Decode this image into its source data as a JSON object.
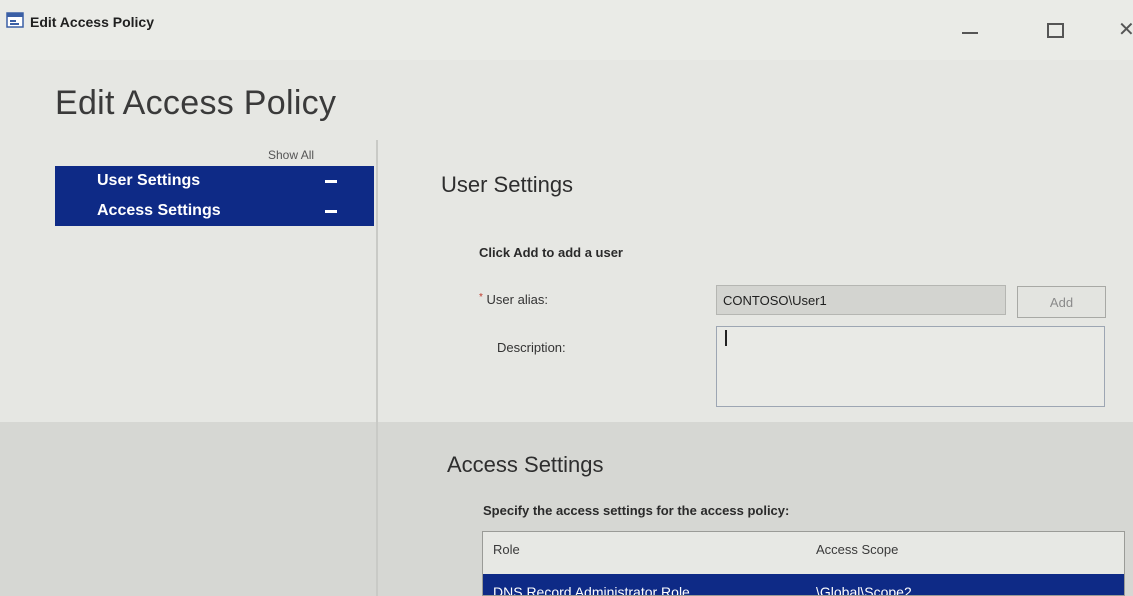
{
  "window": {
    "title": "Edit Access Policy"
  },
  "page": {
    "title": "Edit Access Policy"
  },
  "nav": {
    "show_all": "Show All",
    "items": [
      {
        "label": "User Settings",
        "icon": "collapse-icon"
      },
      {
        "label": "Access Settings",
        "icon": "collapse-icon"
      }
    ]
  },
  "user_settings": {
    "title": "User Settings",
    "hint": "Click Add to add a user",
    "alias_label": "User alias:",
    "alias_required_mark": "*",
    "alias_value": "CONTOSO\\User1",
    "add_label": "Add",
    "description_label": "Description:",
    "description_value": ""
  },
  "access_settings": {
    "title": "Access Settings",
    "hint": "Specify the access settings for the access policy:",
    "columns": [
      "Role",
      "Access Scope"
    ],
    "rows": [
      {
        "role": "DNS Record Administrator Role",
        "scope": "\\Global\\Scope2",
        "selected": true
      }
    ]
  },
  "colors": {
    "selection": "#0e2a86",
    "window_bg": "#e6e7e3",
    "required": "#c0392b"
  }
}
